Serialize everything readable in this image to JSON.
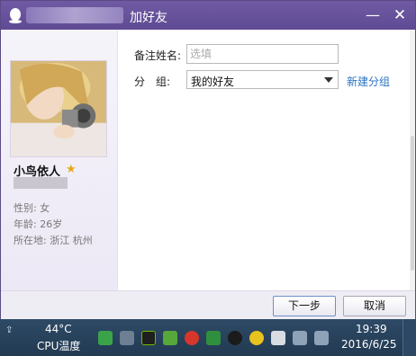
{
  "window": {
    "title": "加好友",
    "minimize_icon": "minimize-icon",
    "close_icon": "close-icon"
  },
  "profile": {
    "nickname": "小鸟依人",
    "gender": "性别: 女",
    "age": "年龄: 26岁",
    "location": "所在地: 浙江  杭州"
  },
  "form": {
    "remark_label": "备注姓名:",
    "remark_placeholder": "选填",
    "remark_value": "",
    "group_label": "分　组:",
    "group_selected": "我的好友",
    "new_group_link": "新建分组"
  },
  "buttons": {
    "next": "下一步",
    "cancel": "取消"
  },
  "taskbar": {
    "cpu_temp": "44°C",
    "cpu_label": "CPU温度",
    "time": "19:39",
    "date": "2016/6/25"
  },
  "colors": {
    "titlebar": "#6f5aa3",
    "link": "#2a73c4",
    "taskbar": "#2e4a66"
  }
}
